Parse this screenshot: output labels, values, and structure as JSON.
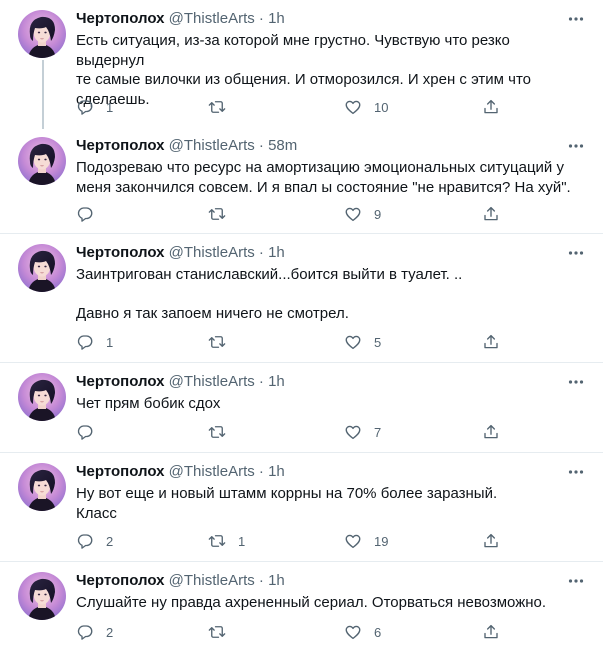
{
  "colors": {
    "text": "#0f1419",
    "secondary": "#536471",
    "divider": "#e6ecf0",
    "thread_line": "#c4cfd6"
  },
  "icons": {
    "reply": "speech-bubble",
    "retweet": "retweet-arrows",
    "like": "heart",
    "share": "share-arrow-up",
    "more": "three-dots"
  },
  "tweets": [
    {
      "name": "Чертополох",
      "handle": "@ThistleArts",
      "dot": "·",
      "time": "1h",
      "text": "Есть ситуация, из-за которой мне грустно. Чувствую что резко выдернул\nте самые вилочки из общения. И отморозился. И хрен с этим что\nсделаешь.",
      "replies": "1",
      "retweets": "",
      "likes": "10"
    },
    {
      "name": "Чертополох",
      "handle": "@ThistleArts",
      "dot": "·",
      "time": "58m",
      "text": "Подозреваю что ресурс на амортизацию  эмоциональных ситуцаций у\nменя закончился совсем. И я впал ы состояние \"не нравится? На хуй\".",
      "replies": "",
      "retweets": "",
      "likes": "9"
    },
    {
      "name": "Чертополох",
      "handle": "@ThistleArts",
      "dot": "·",
      "time": "1h",
      "text": "Заинтригован станиславский...боится выйти в туалет. ..\n\nДавно я так запоем ничего не смотрел.",
      "replies": "1",
      "retweets": "",
      "likes": "5"
    },
    {
      "name": "Чертополох",
      "handle": "@ThistleArts",
      "dot": "·",
      "time": "1h",
      "text": "Чет прям бобик сдох",
      "replies": "",
      "retweets": "",
      "likes": "7"
    },
    {
      "name": "Чертополох",
      "handle": "@ThistleArts",
      "dot": "·",
      "time": "1h",
      "text": "Ну вот еще и новый штамм коррны на 70% более заразный.\nКласс",
      "replies": "2",
      "retweets": "1",
      "likes": "19"
    },
    {
      "name": "Чертополох",
      "handle": "@ThistleArts",
      "dot": "·",
      "time": "1h",
      "text": "Слушайте ну правда ахрененный сериал. Оторваться невозможно.",
      "replies": "2",
      "retweets": "",
      "likes": "6"
    }
  ]
}
